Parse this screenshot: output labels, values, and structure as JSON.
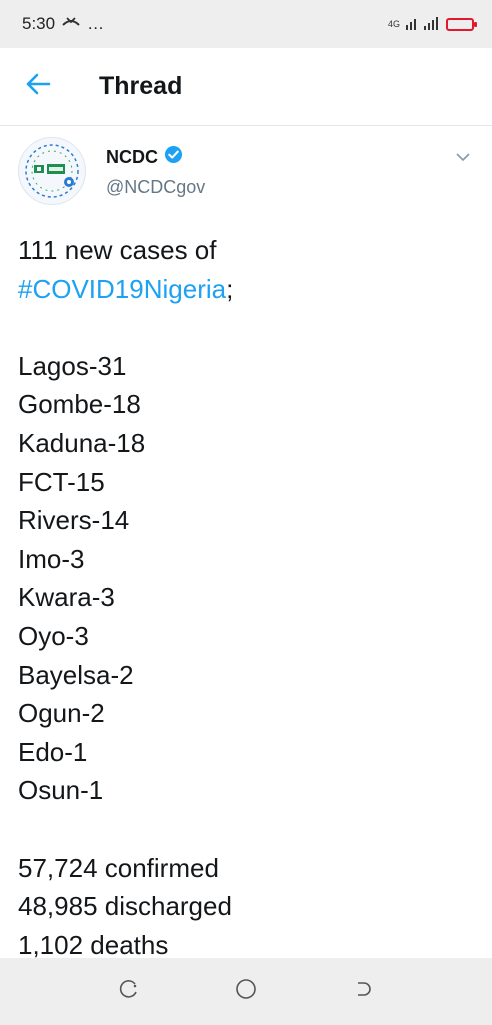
{
  "status_bar": {
    "time": "5:30",
    "notification_icons": "…",
    "network_label": "4G",
    "battery_color": "#e0192f"
  },
  "header": {
    "title": "Thread",
    "back_icon": "arrow-left-icon",
    "accent_color": "#1da1f2"
  },
  "tweet": {
    "author_name": "NCDC",
    "author_handle": "@NCDCgov",
    "verified": true,
    "intro_line": "111 new cases of",
    "hashtag": "#COVID19Nigeria",
    "hashtag_suffix": ";",
    "states": [
      "Lagos-31",
      "Gombe-18",
      "Kaduna-18",
      "FCT-15",
      "Rivers-14",
      "Imo-3",
      "Kwara-3",
      "Oyo-3",
      "Bayelsa-2",
      "Ogun-2",
      "Edo-1",
      "Osun-1"
    ],
    "totals": [
      "57,724 confirmed",
      "48,985 discharged",
      "1,102 deaths"
    ]
  },
  "nav_bar": {
    "icons": [
      "recent-apps-icon",
      "home-icon",
      "back-icon"
    ]
  }
}
